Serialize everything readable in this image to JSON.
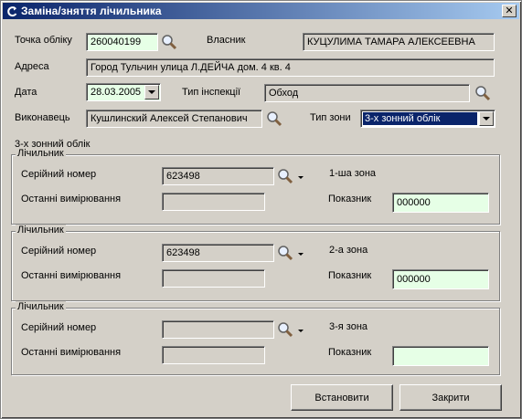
{
  "window": {
    "title": "Заміна/зняття лічильника"
  },
  "labels": {
    "account_point": "Точка обліку",
    "owner": "Власник",
    "address": "Адреса",
    "date": "Дата",
    "inspection_type": "Тип інспекції",
    "performer": "Виконавець",
    "zone_type": "Тип зони"
  },
  "fields": {
    "account_point": "260040199",
    "owner": "КУЦУЛИМА ТАМАРА АЛЕКСЕЕВНА",
    "address": "Город Тульчин улица Л.ДЕЙЧА дом. 4 кв. 4",
    "date": "28.03.2005",
    "inspection_type": "Обход",
    "performer": "Кушлинский Алексей Степанович",
    "zone_type": "3-х зонний облік"
  },
  "section_title": "3-х зонний облік",
  "meters": [
    {
      "caption": "Лічильник",
      "serial_label": "Серійний номер",
      "serial": "623498",
      "last_label": "Останні вимірювання",
      "last": "",
      "zone": "1-ша зона",
      "reading_label": "Показник",
      "reading": "000000"
    },
    {
      "caption": "Лічильник",
      "serial_label": "Серійний номер",
      "serial": "623498",
      "last_label": "Останні вимірювання",
      "last": "",
      "zone": "2-а зона",
      "reading_label": "Показник",
      "reading": "000000"
    },
    {
      "caption": "Лічильник",
      "serial_label": "Серійний номер",
      "serial": "",
      "last_label": "Останні вимірювання",
      "last": "",
      "zone": "3-я зона",
      "reading_label": "Показник",
      "reading": ""
    }
  ],
  "buttons": {
    "install": "Встановити",
    "close": "Закрити"
  },
  "colors": {
    "titlebar": "#0a246a",
    "editable_field": "#e6ffe6",
    "selection": "#0a246a",
    "face": "#d4d0c8"
  },
  "icons": {
    "title": "app-icon",
    "lookup": "magnifier-icon",
    "dropdown": "chevron-down-icon",
    "close": "close-icon"
  }
}
